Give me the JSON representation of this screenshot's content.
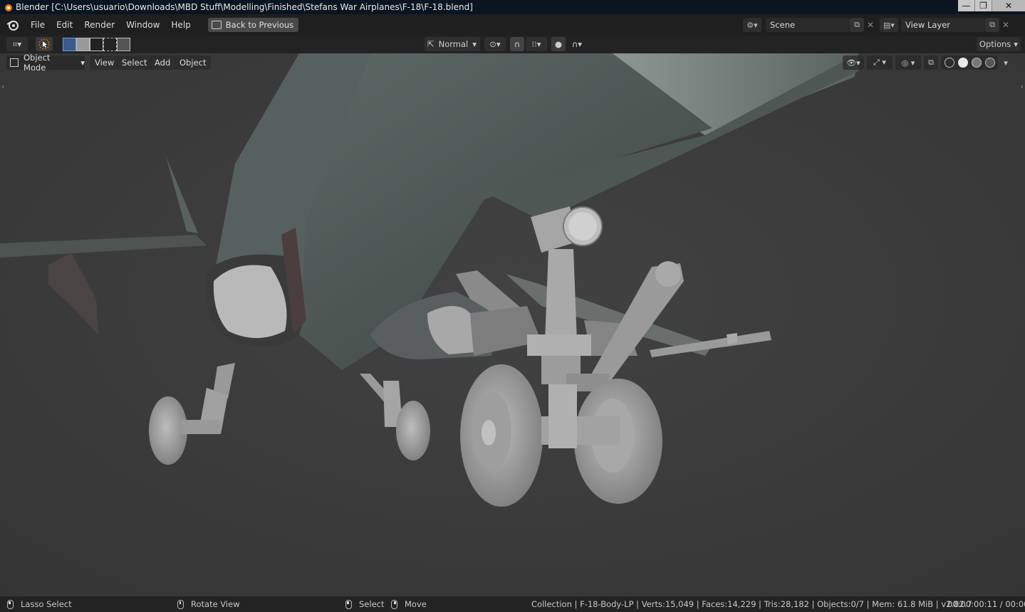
{
  "window": {
    "title": "Blender [C:\\Users\\usuario\\Downloads\\MBD Stuff\\Modelling\\Finished\\Stefans War Airplanes\\F-18\\F-18.blend]",
    "controls": {
      "minimize": "—",
      "maximize": "❐",
      "close": "✕"
    }
  },
  "topbar": {
    "menus": [
      "File",
      "Edit",
      "Render",
      "Window",
      "Help"
    ],
    "back_label": "Back to Previous",
    "scene": "Scene",
    "view_layer": "View Layer"
  },
  "toolheader": {
    "orientation": "Normal",
    "options": "Options"
  },
  "viewport_header": {
    "mode": "Object Mode",
    "menus": [
      "View",
      "Select",
      "Add",
      "Object"
    ]
  },
  "statusbar": {
    "lasso": "Lasso Select",
    "rotate": "Rotate View",
    "select": "Select",
    "move": "Move",
    "stats": "Collection | F-18-Body-LP | Verts:15,049 | Faces:14,229 | Tris:28,182 | Objects:0/7 | Mem: 61.8 MiB | v2.82.7",
    "time": "00:00:00:11 / 00:00:"
  },
  "icons": {
    "app": "blender-icon",
    "editor_type": "3d-viewport-icon",
    "tool": "select-tool-icon"
  }
}
